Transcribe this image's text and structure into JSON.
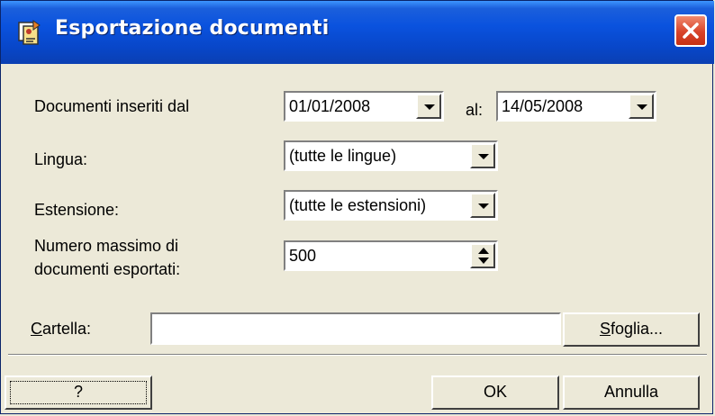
{
  "window": {
    "title": "Esportazione documenti"
  },
  "icons": {
    "title": "documents-export-icon",
    "close": "close-icon"
  },
  "form": {
    "date_from_label": "Documenti inseriti dal",
    "date_from_value": "01/01/2008",
    "date_to_label": "al:",
    "date_to_value": "14/05/2008",
    "language_label": "Lingua:",
    "language_value": "(tutte le lingue)",
    "extension_label": "Estensione:",
    "extension_value": "(tutte le estensioni)",
    "max_docs_label_line1": "Numero massimo di",
    "max_docs_label_line2": "documenti esportati:",
    "max_docs_value": "500",
    "folder_label_accel": "C",
    "folder_label_rest": "artella:",
    "folder_value": "",
    "browse_accel": "S",
    "browse_rest": "foglia..."
  },
  "buttons": {
    "help": "?",
    "ok": "OK",
    "cancel": "Annulla"
  },
  "colors": {
    "titlebar": "#0a52de",
    "close": "#d8432a",
    "face": "#ece9d8"
  }
}
